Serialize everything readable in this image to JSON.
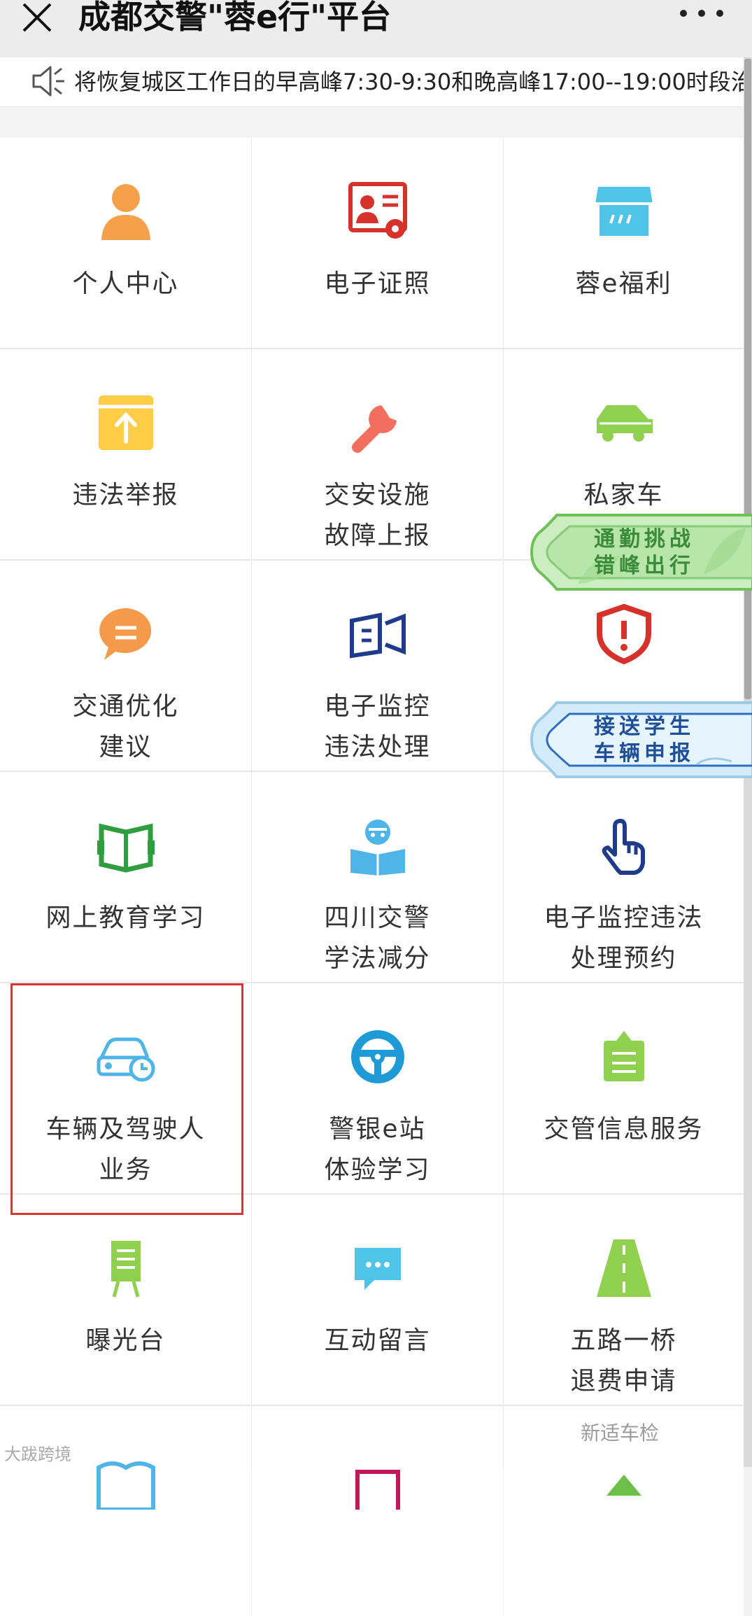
{
  "header": {
    "title": "成都交警\"蓉e行\"平台"
  },
  "notice": {
    "text": "将恢复城区工作日的早高峰7:30-9:30和晚高峰17:00--19:00时段治"
  },
  "tiles": [
    {
      "icon": "person-icon",
      "label_lines": [
        "个人中心"
      ]
    },
    {
      "icon": "id-license-icon",
      "label_lines": [
        "电子证照"
      ]
    },
    {
      "icon": "shop-icon",
      "label_lines": [
        "蓉e福利"
      ]
    },
    {
      "icon": "upload-report-icon",
      "label_lines": [
        "违法举报"
      ]
    },
    {
      "icon": "wrench-icon",
      "label_lines": [
        "交安设施",
        "故障上报"
      ]
    },
    {
      "icon": "car-icon",
      "label_lines": [
        "私家车",
        ""
      ]
    },
    {
      "icon": "chat-bubble-icon",
      "label_lines": [
        "交通优化",
        "建议"
      ]
    },
    {
      "icon": "camera-icon",
      "label_lines": [
        "电子监控",
        "违法处理"
      ]
    },
    {
      "icon": "shield-alert-icon",
      "label_lines": [
        "",
        ""
      ]
    },
    {
      "icon": "book-icon",
      "label_lines": [
        "网上教育学习"
      ]
    },
    {
      "icon": "reader-icon",
      "label_lines": [
        "四川交警",
        "学法减分"
      ]
    },
    {
      "icon": "hand-pointer-icon",
      "label_lines": [
        "电子监控违法",
        "处理预约"
      ]
    },
    {
      "icon": "car-clock-icon",
      "label_lines": [
        "车辆及驾驶人",
        "业务"
      ]
    },
    {
      "icon": "steering-wheel-icon",
      "label_lines": [
        "警银e站",
        "体验学习"
      ]
    },
    {
      "icon": "clipboard-icon",
      "label_lines": [
        "交管信息服务"
      ]
    },
    {
      "icon": "display-board-icon",
      "label_lines": [
        "曝光台"
      ]
    },
    {
      "icon": "message-icon",
      "label_lines": [
        "互动留言"
      ]
    },
    {
      "icon": "road-icon",
      "label_lines": [
        "五路一桥",
        "退费申请"
      ]
    },
    {
      "icon": "book-open-icon",
      "label_lines": []
    },
    {
      "icon": "frame-icon",
      "label_lines": []
    },
    {
      "icon": "arrow-icon",
      "label_lines": []
    }
  ],
  "floating_badges": [
    {
      "line1": "通勤挑战",
      "line2": "错峰出行",
      "color": "#4aa84a"
    },
    {
      "line1": "接送学生",
      "line2": "车辆申报",
      "color": "#2d6fc0"
    }
  ],
  "watermarks": {
    "left": "大跋跨境",
    "right": "新适车检"
  }
}
